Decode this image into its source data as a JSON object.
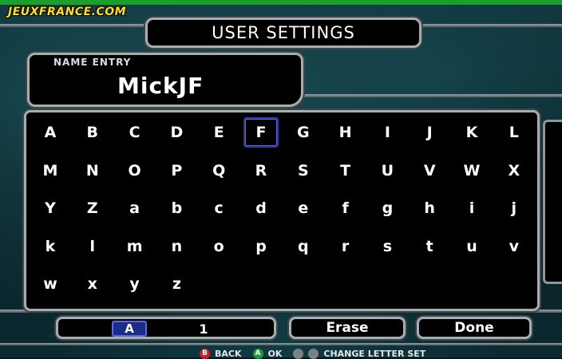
{
  "brand": "JEUXFRANCE.COM",
  "title": "USER SETTINGS",
  "name_entry": {
    "label": "NAME ENTRY",
    "value": "MickJF"
  },
  "keyboard": {
    "selected": "F",
    "rows": [
      [
        "A",
        "B",
        "C",
        "D",
        "E",
        "F",
        "G",
        "H",
        "I",
        "J",
        "K",
        "L"
      ],
      [
        "M",
        "N",
        "O",
        "P",
        "Q",
        "R",
        "S",
        "T",
        "U",
        "V",
        "W",
        "X"
      ],
      [
        "Y",
        "Z",
        "a",
        "b",
        "c",
        "d",
        "e",
        "f",
        "g",
        "h",
        "i",
        "j"
      ],
      [
        "k",
        "l",
        "m",
        "n",
        "o",
        "p",
        "q",
        "r",
        "s",
        "t",
        "u",
        "v"
      ],
      [
        "w",
        "x",
        "y",
        "z"
      ]
    ]
  },
  "bottom": {
    "letter_set_label": "A",
    "letter_set_number": "1",
    "erase_label": "Erase",
    "done_label": "Done"
  },
  "hints": {
    "back_button": "B",
    "back_label": "BACK",
    "ok_button": "A",
    "ok_label": "OK",
    "change_label": "CHANGE LETTER SET"
  },
  "colors": {
    "brand_yellow": "#ffe600",
    "top_green": "#1b9f2b",
    "selection_blue": "#2e3aa8",
    "back_red": "#c8202a",
    "ok_green": "#1f9a3a"
  }
}
